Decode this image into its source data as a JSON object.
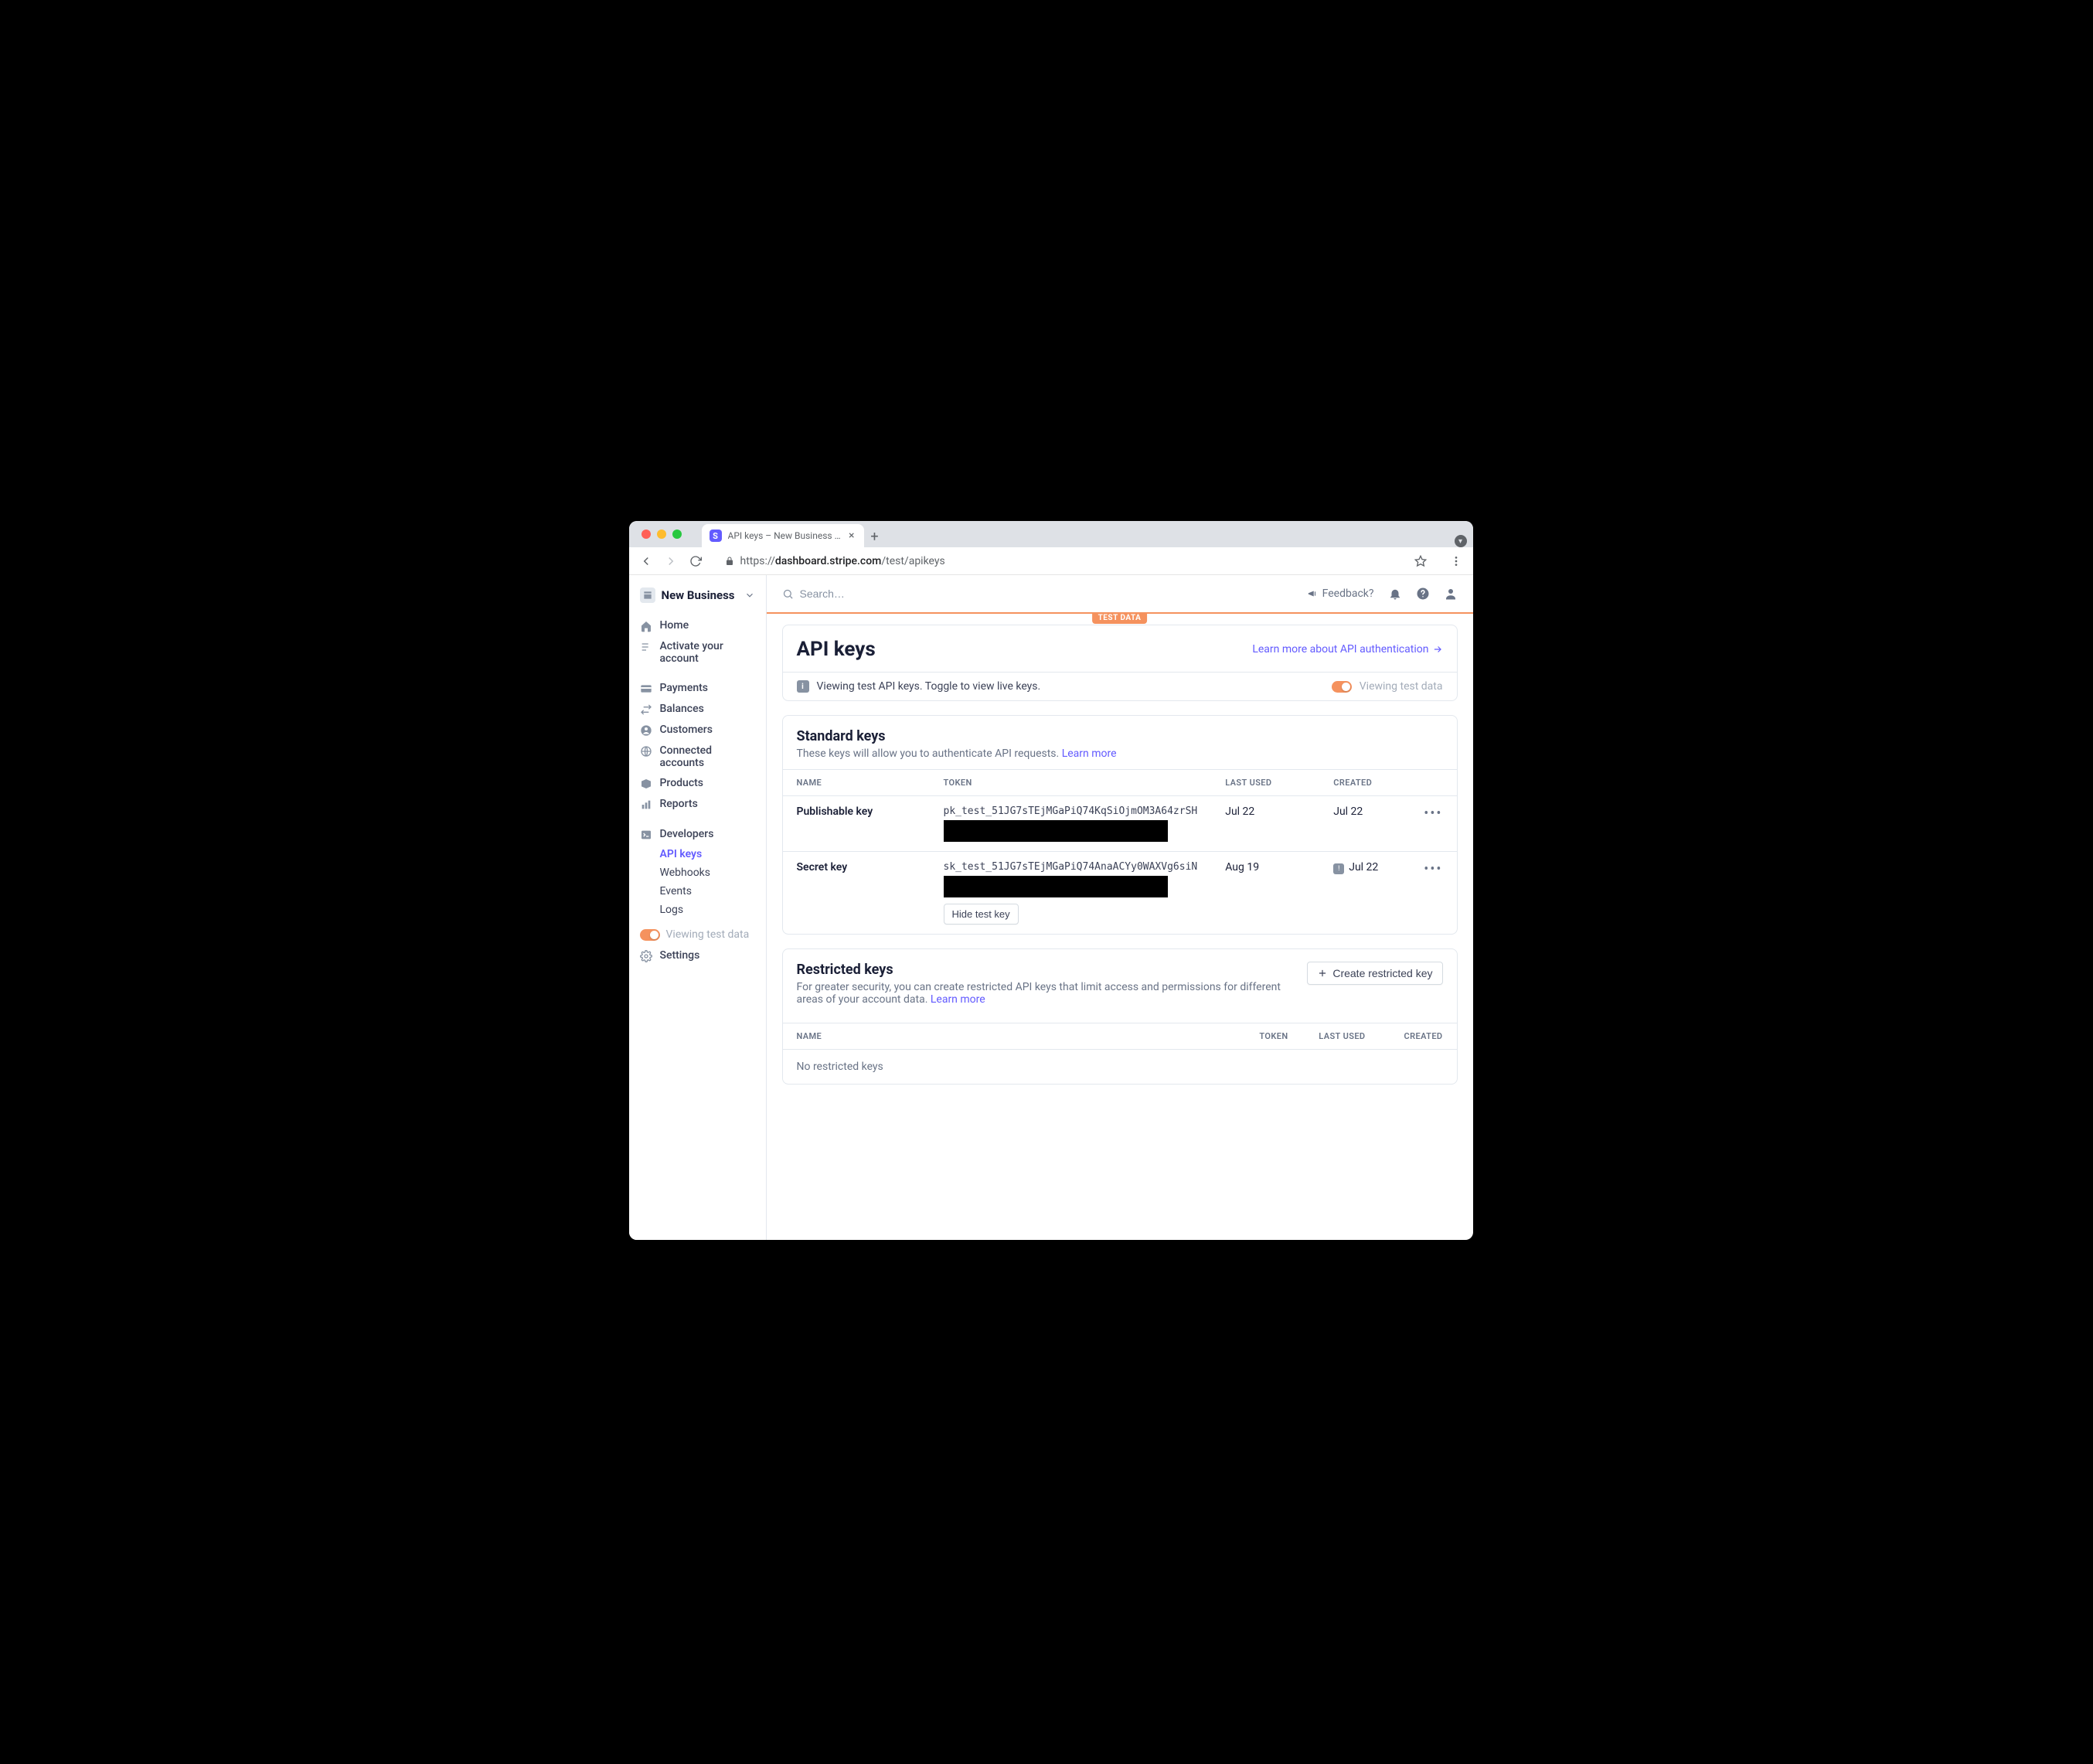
{
  "browser": {
    "tab_title": "API keys – New Business – Str",
    "url_prefix": "https://",
    "url_host": "dashboard.stripe.com",
    "url_path": "/test/apikeys"
  },
  "account": {
    "name": "New Business"
  },
  "sidebar": {
    "home": "Home",
    "activate": "Activate your account",
    "payments": "Payments",
    "balances": "Balances",
    "customers": "Customers",
    "connected": "Connected accounts",
    "products": "Products",
    "reports": "Reports",
    "developers": "Developers",
    "api_keys": "API keys",
    "webhooks": "Webhooks",
    "events": "Events",
    "logs": "Logs",
    "viewing_test": "Viewing test data",
    "settings": "Settings"
  },
  "topbar": {
    "search_placeholder": "Search…",
    "feedback": "Feedback?"
  },
  "banner": {
    "test_data": "TEST DATA"
  },
  "page": {
    "title": "API keys",
    "learn_more": "Learn more about API authentication",
    "info_msg": "Viewing test API keys. Toggle to view live keys.",
    "info_toggle_label": "Viewing test data"
  },
  "standard": {
    "title": "Standard keys",
    "subtitle": "These keys will allow you to authenticate API requests. ",
    "learn_more": "Learn more",
    "cols": {
      "name": "NAME",
      "token": "TOKEN",
      "last_used": "LAST USED",
      "created": "CREATED"
    },
    "rows": [
      {
        "name": "Publishable key",
        "token": "pk_test_51JG7sTEjMGaPiQ74KqSiOjmOM3A64zrSH",
        "last_used": "Jul 22",
        "created": "Jul 22"
      },
      {
        "name": "Secret key",
        "token": "sk_test_51JG7sTEjMGaPiQ74AnaACYy0WAXVg6siN",
        "last_used": "Aug 19",
        "created": "Jul 22",
        "hide_label": "Hide test key",
        "warn": true
      }
    ]
  },
  "restricted": {
    "title": "Restricted keys",
    "subtitle_a": "For greater security, you can create restricted API keys that limit access and permissions for different areas of your account data. ",
    "learn_more": "Learn more",
    "create_label": "Create restricted key",
    "cols": {
      "name": "NAME",
      "token": "TOKEN",
      "last_used": "LAST USED",
      "created": "CREATED"
    },
    "empty": "No restricted keys"
  }
}
